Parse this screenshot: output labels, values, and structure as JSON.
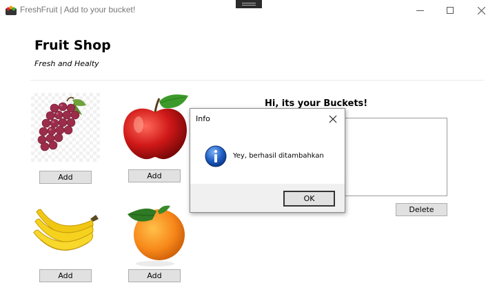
{
  "window": {
    "title": "FreshFruit | Add to your bucket!",
    "icon": "fruit-basket-icon"
  },
  "header": {
    "title": "Fruit Shop",
    "subtitle": "Fresh and Healty"
  },
  "products": [
    {
      "name": "grapes",
      "image": "grapes-image",
      "button": "Add"
    },
    {
      "name": "apple",
      "image": "apple-image",
      "button": "Add"
    },
    {
      "name": "banana",
      "image": "banana-image",
      "button": "Add"
    },
    {
      "name": "orange",
      "image": "orange-image",
      "button": "Add"
    }
  ],
  "bucket": {
    "title": "Hi, its your Buckets!",
    "items": [],
    "delete_label": "Delete"
  },
  "dialog": {
    "title": "Info",
    "message": "Yey, berhasil ditambahkan",
    "icon": "info-icon",
    "ok_label": "OK"
  },
  "colors": {
    "button_bg": "#e1e1e1",
    "dialog_footer": "#f0f0f0",
    "info_icon": "#1f5fc6"
  }
}
